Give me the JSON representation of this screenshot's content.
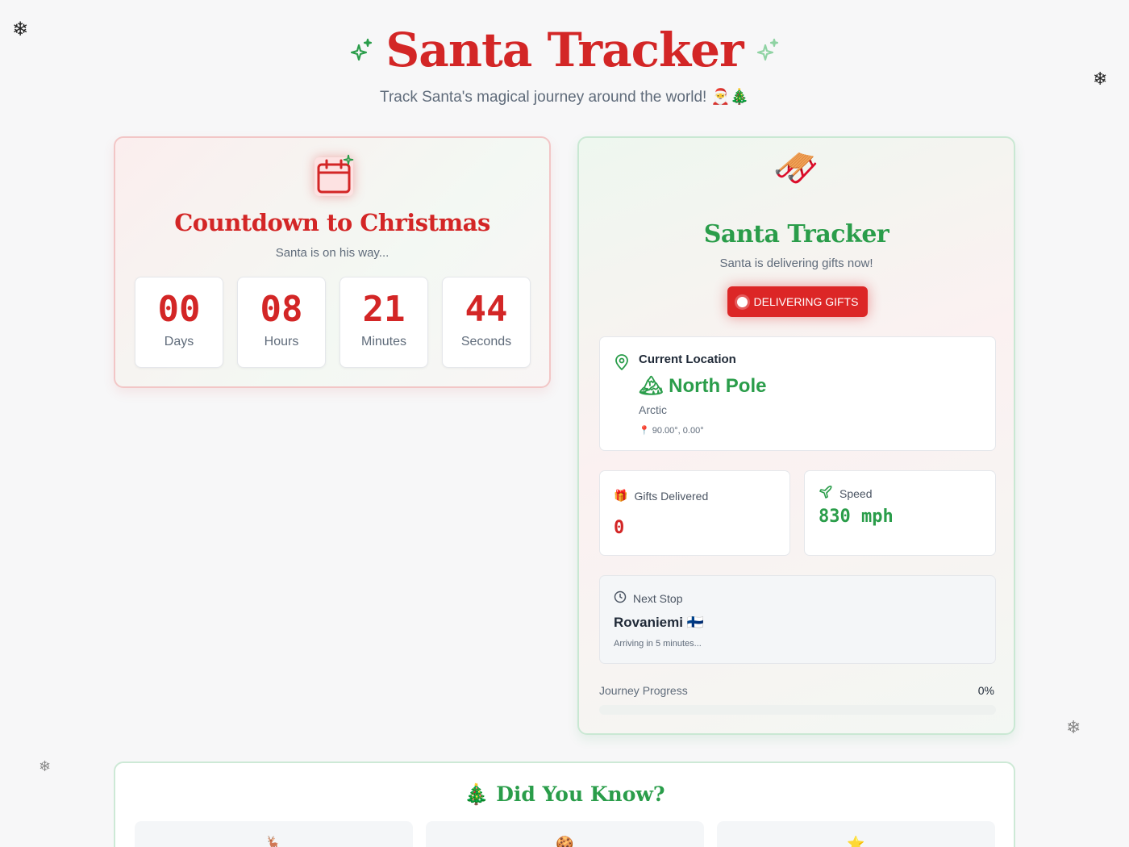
{
  "header": {
    "title": "Santa Tracker",
    "subtitle": "Track Santa's magical journey around the world! 🎅🎄"
  },
  "decorations": {
    "top_left": "❄",
    "top_right": "❄",
    "bottom_left": "❄",
    "bottom_right": "❄"
  },
  "countdown": {
    "title": "Countdown to Christmas",
    "tagline": "Santa is on his way...",
    "units": [
      {
        "value": "00",
        "label": "Days"
      },
      {
        "value": "08",
        "label": "Hours"
      },
      {
        "value": "21",
        "label": "Minutes"
      },
      {
        "value": "44",
        "label": "Seconds"
      }
    ]
  },
  "tracker": {
    "icon": "🛷",
    "title": "Santa Tracker",
    "tagline": "Santa is delivering gifts now!",
    "status": "DELIVERING GIFTS",
    "location": {
      "heading": "Current Location",
      "name": "🏔 North Pole",
      "region": "Arctic",
      "coords": "📍 90.00°, 0.00°"
    },
    "gifts": {
      "label": "Gifts Delivered",
      "icon": "🎁",
      "value": "0"
    },
    "speed": {
      "label": "Speed",
      "value": "830 mph"
    },
    "next_stop": {
      "heading": "Next Stop",
      "city": "Rovaniemi 🇫🇮",
      "eta": "Arriving in 5 minutes..."
    },
    "progress": {
      "label": "Journey Progress",
      "percent_text": "0%",
      "percent": 0
    }
  },
  "facts": {
    "title": "🎄 Did You Know?",
    "cards": [
      {
        "icon": "🦌"
      },
      {
        "icon": "🍪"
      },
      {
        "icon": "⭐"
      }
    ]
  },
  "colors": {
    "red": "#d32626",
    "green": "#2a9d4a"
  }
}
